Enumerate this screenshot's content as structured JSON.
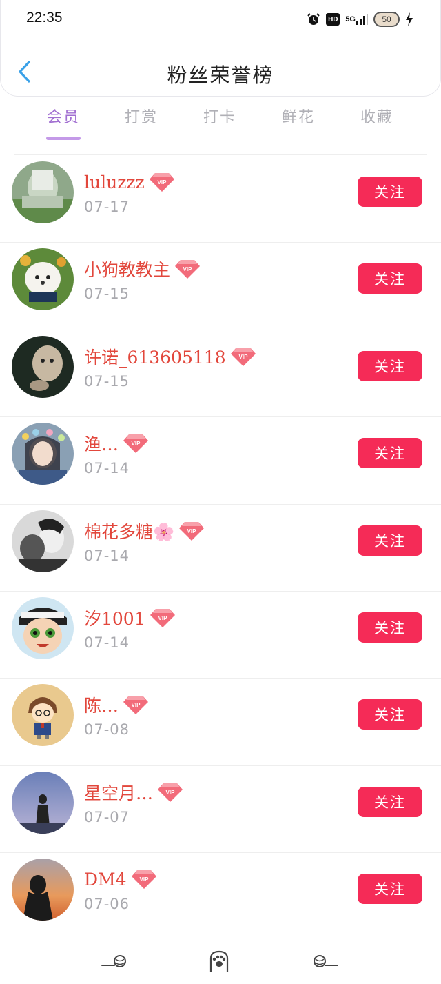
{
  "status_bar": {
    "time": "22:35",
    "icons": [
      "alarm-icon",
      "hd-icon",
      "signal-5g-icon",
      "battery-icon",
      "charging-icon"
    ],
    "hd_label": "HD",
    "network_label": "5G",
    "battery_level": "50"
  },
  "header": {
    "back_icon": "chevron-left-icon",
    "title": "粉丝荣誉榜"
  },
  "tabs": [
    {
      "label": "会员",
      "active": true
    },
    {
      "label": "打赏",
      "active": false
    },
    {
      "label": "打卡",
      "active": false
    },
    {
      "label": "鲜花",
      "active": false
    },
    {
      "label": "收藏",
      "active": false
    }
  ],
  "fans": [
    {
      "name": "luluzzz",
      "date": "07-17",
      "vip": true,
      "follow_label": "关注"
    },
    {
      "name": "小狗教教主",
      "date": "07-15",
      "vip": true,
      "follow_label": "关注"
    },
    {
      "name": "许诺_613605118",
      "date": "07-15",
      "vip": true,
      "follow_label": "关注"
    },
    {
      "name": "渔…",
      "date": "07-14",
      "vip": true,
      "follow_label": "关注"
    },
    {
      "name": "棉花多糖🌸",
      "date": "07-14",
      "vip": true,
      "follow_label": "关注"
    },
    {
      "name": "汐1001",
      "date": "07-14",
      "vip": true,
      "follow_label": "关注"
    },
    {
      "name": "陈…",
      "date": "07-08",
      "vip": true,
      "follow_label": "关注"
    },
    {
      "name": "星空月…",
      "date": "07-07",
      "vip": true,
      "follow_label": "关注"
    },
    {
      "name": "DM4",
      "date": "07-06",
      "vip": true,
      "follow_label": "关注"
    }
  ],
  "vip_badge_label": "VIP",
  "bottom_nav": {
    "items": [
      "yarn-ball-left-icon",
      "cat-paw-icon",
      "yarn-ball-right-icon"
    ]
  },
  "colors": {
    "accent_purple": "#a16fd1",
    "tab_underline": "#c49ae8",
    "name_red": "#e2473c",
    "follow_button": "#f52b57",
    "date_gray": "#a9a9ae",
    "back_blue": "#3aa1e8"
  }
}
